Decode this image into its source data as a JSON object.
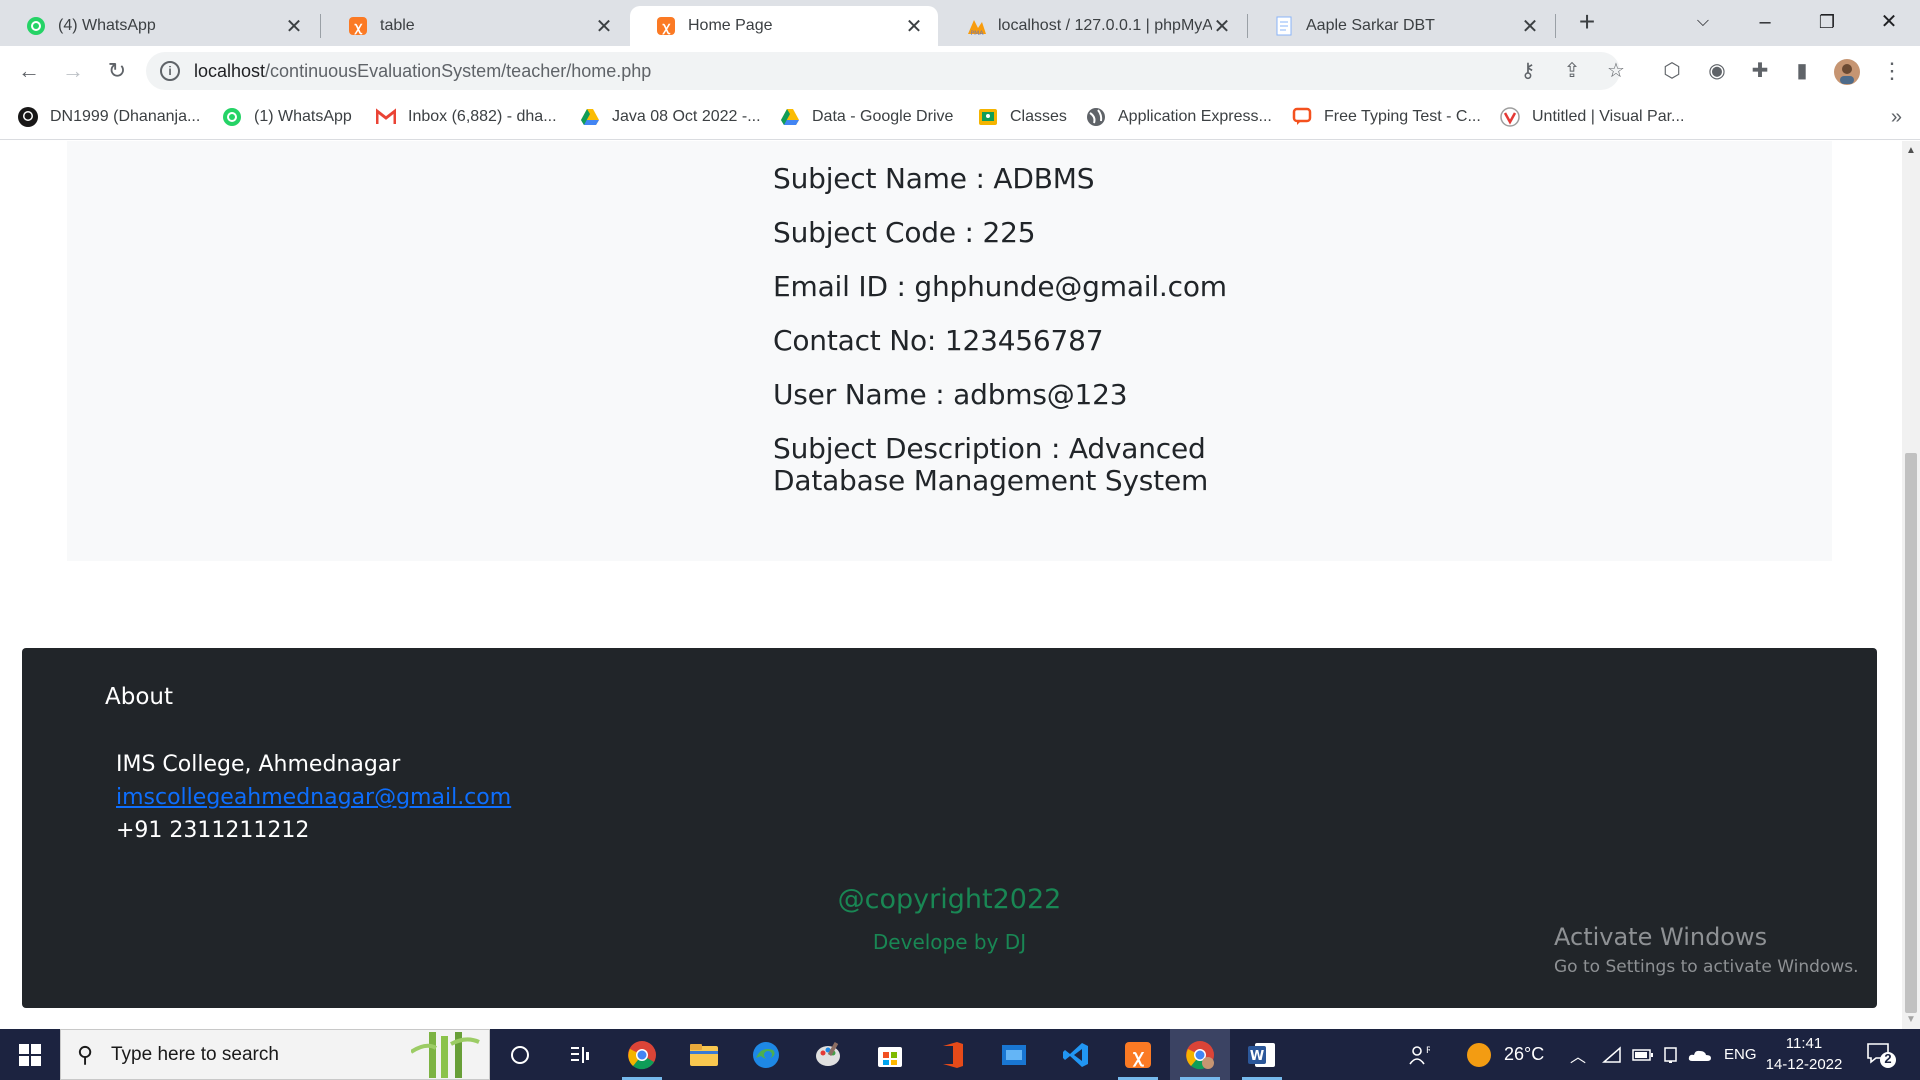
{
  "browser": {
    "tabs": [
      {
        "title": "(4) WhatsApp",
        "icon": "whatsapp-icon",
        "active": false
      },
      {
        "title": "table",
        "icon": "xampp-icon",
        "active": false
      },
      {
        "title": "Home Page",
        "icon": "xampp-icon",
        "active": true
      },
      {
        "title": "localhost / 127.0.0.1 | phpMyA",
        "icon": "phpmyadmin-icon",
        "active": false
      },
      {
        "title": "Aaple Sarkar DBT",
        "icon": "document-icon",
        "active": false
      }
    ],
    "url_host": "localhost",
    "url_path": "/continuousEvaluationSystem/teacher/home.php",
    "bookmarks": [
      {
        "label": "DN1999 (Dhananja...",
        "icon": "github-icon"
      },
      {
        "label": "(1) WhatsApp",
        "icon": "whatsapp-icon"
      },
      {
        "label": "Inbox (6,882) - dha...",
        "icon": "gmail-icon"
      },
      {
        "label": "Java 08 Oct 2022 -...",
        "icon": "google-drive-icon"
      },
      {
        "label": "Data - Google Drive",
        "icon": "google-drive-icon"
      },
      {
        "label": "Classes",
        "icon": "classroom-icon"
      },
      {
        "label": "Application Express...",
        "icon": "globe-icon"
      },
      {
        "label": "Free Typing Test - C...",
        "icon": "chat-icon"
      },
      {
        "label": "Untitled | Visual Par...",
        "icon": "visual-paradigm-icon"
      }
    ]
  },
  "subject": {
    "name": "Subject Name : ADBMS",
    "code": "Subject Code : 225",
    "email": "Email ID : ghphunde@gmail.com",
    "contact": "Contact No: 123456787",
    "username": "User Name : adbms@123",
    "description": "Subject Description : Advanced Database Management System"
  },
  "footer": {
    "about": "About",
    "college": "IMS College, Ahmednagar",
    "email": "imscollegeahmednagar@gmail.com",
    "phone": "+91 2311211212",
    "copyright": "@copyright2022",
    "developer": "Develope by DJ"
  },
  "watermark": {
    "line1": "Activate Windows",
    "line2": "Go to Settings to activate Windows."
  },
  "taskbar": {
    "search_placeholder": "Type here to search",
    "weather": "26°C",
    "language": "ENG",
    "time": "11:41",
    "date": "14-12-2022",
    "notifications": "2"
  },
  "colors": {
    "footer_bg": "#212529",
    "footer_green": "#198754",
    "link_blue": "#0d6efd",
    "card_bg": "#f8f9fa"
  }
}
